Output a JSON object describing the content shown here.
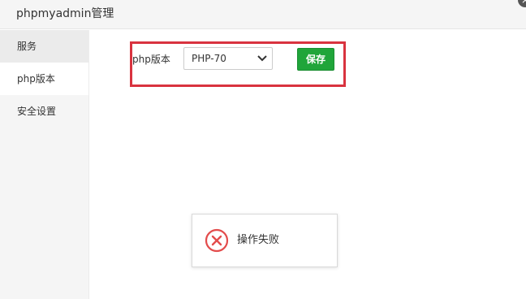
{
  "dialog": {
    "title": "phpmyadmin管理",
    "close_label": "×"
  },
  "sidebar": {
    "items": [
      {
        "label": "服务"
      },
      {
        "label": "php版本"
      },
      {
        "label": "安全设置"
      }
    ]
  },
  "php_version": {
    "label": "php版本",
    "selected": "PHP-70",
    "save_label": "保存"
  },
  "toast": {
    "message": "操作失败",
    "icon": "error-x-circle-icon",
    "icon_color": "#e34c4c"
  },
  "colors": {
    "accent_green": "#20a53a",
    "highlight_red": "#d9333f"
  }
}
